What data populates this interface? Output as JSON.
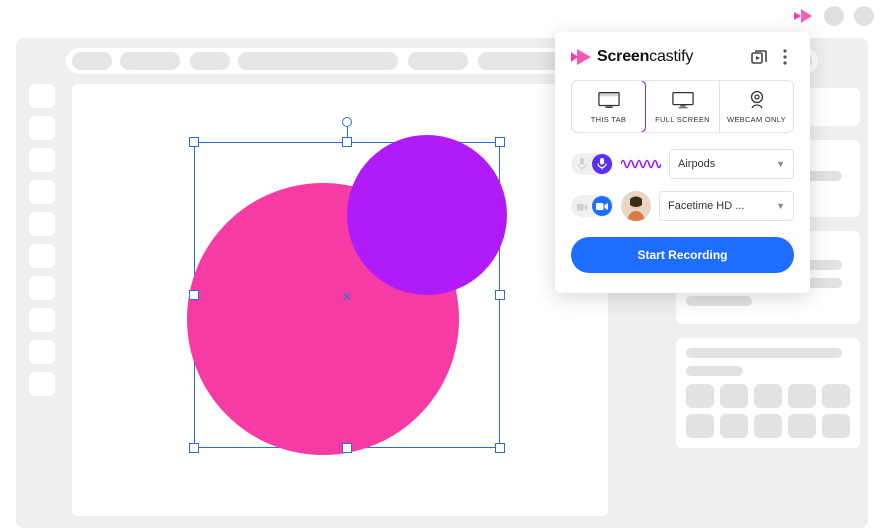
{
  "brand": {
    "name_bold": "Screen",
    "name_rest": "castify"
  },
  "modes": {
    "this_tab": "THIS TAB",
    "full_screen": "FULL SCREEN",
    "webcam_only": "WEBCAM ONLY"
  },
  "mic": {
    "device": "Airpods"
  },
  "cam": {
    "device": "Facetime HD ..."
  },
  "actions": {
    "start": "Start Recording"
  },
  "colors": {
    "accent_purple": "#9a1bf7",
    "accent_blue": "#1f6dff",
    "brand_pink": "#f73ba5"
  }
}
